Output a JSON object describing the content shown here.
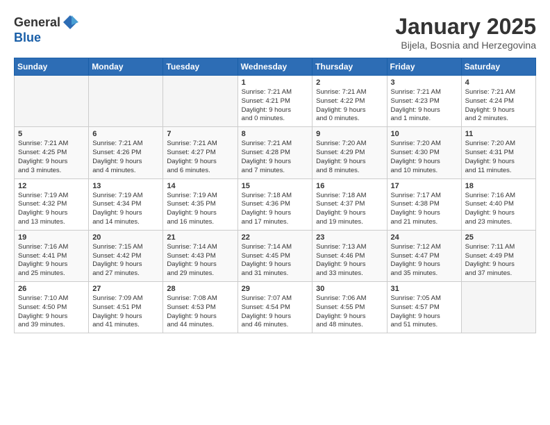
{
  "header": {
    "logo_general": "General",
    "logo_blue": "Blue",
    "month_title": "January 2025",
    "location": "Bijela, Bosnia and Herzegovina"
  },
  "weekdays": [
    "Sunday",
    "Monday",
    "Tuesday",
    "Wednesday",
    "Thursday",
    "Friday",
    "Saturday"
  ],
  "weeks": [
    [
      {
        "day": "",
        "info": ""
      },
      {
        "day": "",
        "info": ""
      },
      {
        "day": "",
        "info": ""
      },
      {
        "day": "1",
        "info": "Sunrise: 7:21 AM\nSunset: 4:21 PM\nDaylight: 9 hours\nand 0 minutes."
      },
      {
        "day": "2",
        "info": "Sunrise: 7:21 AM\nSunset: 4:22 PM\nDaylight: 9 hours\nand 0 minutes."
      },
      {
        "day": "3",
        "info": "Sunrise: 7:21 AM\nSunset: 4:23 PM\nDaylight: 9 hours\nand 1 minute."
      },
      {
        "day": "4",
        "info": "Sunrise: 7:21 AM\nSunset: 4:24 PM\nDaylight: 9 hours\nand 2 minutes."
      }
    ],
    [
      {
        "day": "5",
        "info": "Sunrise: 7:21 AM\nSunset: 4:25 PM\nDaylight: 9 hours\nand 3 minutes."
      },
      {
        "day": "6",
        "info": "Sunrise: 7:21 AM\nSunset: 4:26 PM\nDaylight: 9 hours\nand 4 minutes."
      },
      {
        "day": "7",
        "info": "Sunrise: 7:21 AM\nSunset: 4:27 PM\nDaylight: 9 hours\nand 6 minutes."
      },
      {
        "day": "8",
        "info": "Sunrise: 7:21 AM\nSunset: 4:28 PM\nDaylight: 9 hours\nand 7 minutes."
      },
      {
        "day": "9",
        "info": "Sunrise: 7:20 AM\nSunset: 4:29 PM\nDaylight: 9 hours\nand 8 minutes."
      },
      {
        "day": "10",
        "info": "Sunrise: 7:20 AM\nSunset: 4:30 PM\nDaylight: 9 hours\nand 10 minutes."
      },
      {
        "day": "11",
        "info": "Sunrise: 7:20 AM\nSunset: 4:31 PM\nDaylight: 9 hours\nand 11 minutes."
      }
    ],
    [
      {
        "day": "12",
        "info": "Sunrise: 7:19 AM\nSunset: 4:32 PM\nDaylight: 9 hours\nand 13 minutes."
      },
      {
        "day": "13",
        "info": "Sunrise: 7:19 AM\nSunset: 4:34 PM\nDaylight: 9 hours\nand 14 minutes."
      },
      {
        "day": "14",
        "info": "Sunrise: 7:19 AM\nSunset: 4:35 PM\nDaylight: 9 hours\nand 16 minutes."
      },
      {
        "day": "15",
        "info": "Sunrise: 7:18 AM\nSunset: 4:36 PM\nDaylight: 9 hours\nand 17 minutes."
      },
      {
        "day": "16",
        "info": "Sunrise: 7:18 AM\nSunset: 4:37 PM\nDaylight: 9 hours\nand 19 minutes."
      },
      {
        "day": "17",
        "info": "Sunrise: 7:17 AM\nSunset: 4:38 PM\nDaylight: 9 hours\nand 21 minutes."
      },
      {
        "day": "18",
        "info": "Sunrise: 7:16 AM\nSunset: 4:40 PM\nDaylight: 9 hours\nand 23 minutes."
      }
    ],
    [
      {
        "day": "19",
        "info": "Sunrise: 7:16 AM\nSunset: 4:41 PM\nDaylight: 9 hours\nand 25 minutes."
      },
      {
        "day": "20",
        "info": "Sunrise: 7:15 AM\nSunset: 4:42 PM\nDaylight: 9 hours\nand 27 minutes."
      },
      {
        "day": "21",
        "info": "Sunrise: 7:14 AM\nSunset: 4:43 PM\nDaylight: 9 hours\nand 29 minutes."
      },
      {
        "day": "22",
        "info": "Sunrise: 7:14 AM\nSunset: 4:45 PM\nDaylight: 9 hours\nand 31 minutes."
      },
      {
        "day": "23",
        "info": "Sunrise: 7:13 AM\nSunset: 4:46 PM\nDaylight: 9 hours\nand 33 minutes."
      },
      {
        "day": "24",
        "info": "Sunrise: 7:12 AM\nSunset: 4:47 PM\nDaylight: 9 hours\nand 35 minutes."
      },
      {
        "day": "25",
        "info": "Sunrise: 7:11 AM\nSunset: 4:49 PM\nDaylight: 9 hours\nand 37 minutes."
      }
    ],
    [
      {
        "day": "26",
        "info": "Sunrise: 7:10 AM\nSunset: 4:50 PM\nDaylight: 9 hours\nand 39 minutes."
      },
      {
        "day": "27",
        "info": "Sunrise: 7:09 AM\nSunset: 4:51 PM\nDaylight: 9 hours\nand 41 minutes."
      },
      {
        "day": "28",
        "info": "Sunrise: 7:08 AM\nSunset: 4:53 PM\nDaylight: 9 hours\nand 44 minutes."
      },
      {
        "day": "29",
        "info": "Sunrise: 7:07 AM\nSunset: 4:54 PM\nDaylight: 9 hours\nand 46 minutes."
      },
      {
        "day": "30",
        "info": "Sunrise: 7:06 AM\nSunset: 4:55 PM\nDaylight: 9 hours\nand 48 minutes."
      },
      {
        "day": "31",
        "info": "Sunrise: 7:05 AM\nSunset: 4:57 PM\nDaylight: 9 hours\nand 51 minutes."
      },
      {
        "day": "",
        "info": ""
      }
    ]
  ]
}
